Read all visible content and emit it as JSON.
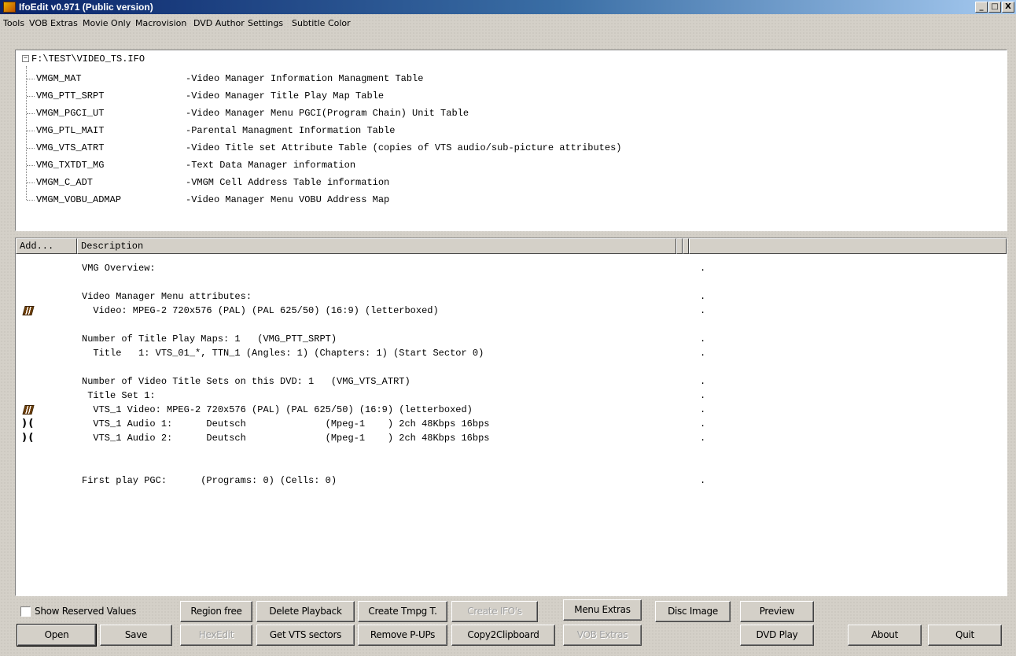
{
  "window": {
    "title": "IfoEdit v0.971 (Public version)",
    "controls": [
      "_",
      "□",
      "X"
    ]
  },
  "menu": [
    "Tools",
    "VOB Extras",
    "Movie Only",
    "Macrovision",
    "DVD Author",
    "Settings",
    "Subtitle Color"
  ],
  "tree": {
    "root": "F:\\TEST\\VIDEO_TS.IFO",
    "items": [
      {
        "name": "VMGM_MAT",
        "desc": "-Video Manager Information Managment Table"
      },
      {
        "name": "VMG_PTT_SRPT",
        "desc": "-Video Manager Title Play Map Table"
      },
      {
        "name": "VMGM_PGCI_UT",
        "desc": "-Video Manager Menu PGCI(Program Chain) Unit Table"
      },
      {
        "name": "VMG_PTL_MAIT",
        "desc": "-Parental Managment Information Table"
      },
      {
        "name": "VMG_VTS_ATRT",
        "desc": "-Video Title set Attribute Table (copies of VTS audio/sub-picture attributes)"
      },
      {
        "name": "VMG_TXTDT_MG",
        "desc": "-Text Data Manager information"
      },
      {
        "name": "VMGM_C_ADT",
        "desc": "-VMGM Cell Address Table information"
      },
      {
        "name": "VMGM_VOBU_ADMAP",
        "desc": "-Video Manager Menu VOBU Address Map"
      }
    ]
  },
  "list": {
    "columns": [
      "Add...",
      "Description"
    ],
    "rows": [
      {
        "icon": "",
        "text": "VMG Overview:",
        "dot": "."
      },
      {
        "icon": "",
        "text": "",
        "dot": ""
      },
      {
        "icon": "",
        "text": "Video Manager Menu attributes:",
        "dot": "."
      },
      {
        "icon": "video",
        "text": "  Video: MPEG-2 720x576 (PAL) (PAL 625/50) (16:9) (letterboxed)",
        "dot": "."
      },
      {
        "icon": "",
        "text": "",
        "dot": ""
      },
      {
        "icon": "",
        "text": "Number of Title Play Maps: 1   (VMG_PTT_SRPT)",
        "dot": "."
      },
      {
        "icon": "",
        "text": "  Title   1: VTS_01_*, TTN_1 (Angles: 1) (Chapters: 1) (Start Sector 0)",
        "dot": "."
      },
      {
        "icon": "",
        "text": "",
        "dot": ""
      },
      {
        "icon": "",
        "text": "Number of Video Title Sets on this DVD: 1   (VMG_VTS_ATRT)",
        "dot": "."
      },
      {
        "icon": "",
        "text": " Title Set 1:",
        "dot": "."
      },
      {
        "icon": "video",
        "text": "  VTS_1 Video: MPEG-2 720x576 (PAL) (PAL 625/50) (16:9) (letterboxed)",
        "dot": "."
      },
      {
        "icon": "audio",
        "text": "  VTS_1 Audio 1:      Deutsch              (Mpeg-1    ) 2ch 48Kbps 16bps",
        "dot": "."
      },
      {
        "icon": "audio",
        "text": "  VTS_1 Audio 2:      Deutsch              (Mpeg-1    ) 2ch 48Kbps 16bps",
        "dot": "."
      },
      {
        "icon": "",
        "text": "",
        "dot": ""
      },
      {
        "icon": "",
        "text": "",
        "dot": ""
      },
      {
        "icon": "",
        "text": "First play PGC:      (Programs: 0) (Cells: 0)",
        "dot": "."
      }
    ]
  },
  "options": {
    "show_reserved_label": "Show Reserved Values"
  },
  "buttons": {
    "region_free": "Region free",
    "delete_playback": "Delete Playback",
    "create_tmpg": "Create Tmpg T.",
    "create_ifos": "Create IFO's",
    "menu_extras": "Menu Extras",
    "disc_image": "Disc Image",
    "preview": "Preview",
    "open": "Open",
    "save": "Save",
    "hexedit": "HexEdit",
    "get_vts_sectors": "Get VTS sectors",
    "remove_pups": "Remove P-UPs",
    "copy2clipboard": "Copy2Clipboard",
    "vob_extras": "VOB Extras",
    "dvd_play": "DVD Play",
    "about": "About",
    "quit": "Quit"
  },
  "icons": {
    "video": "film-icon",
    "audio": "audio-icon"
  }
}
